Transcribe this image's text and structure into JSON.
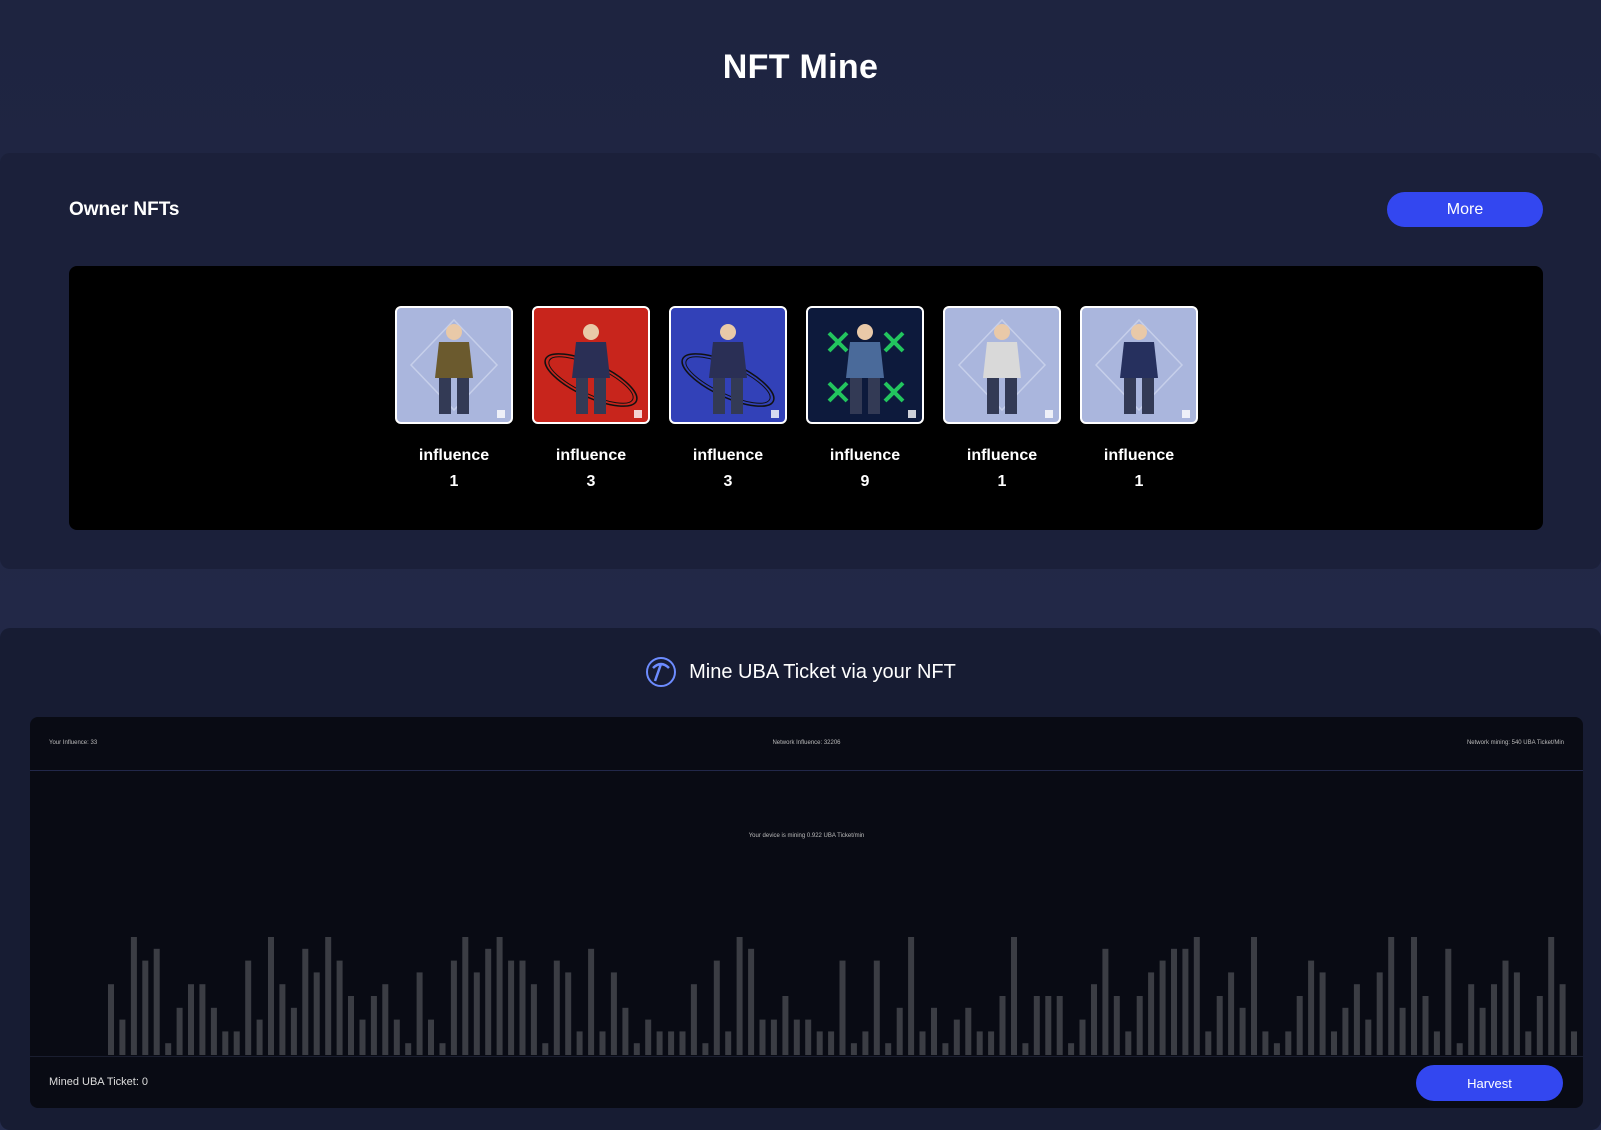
{
  "page": {
    "title": "NFT Mine"
  },
  "owner": {
    "title": "Owner NFTs",
    "more_label": "More",
    "nfts": [
      {
        "label": "influence",
        "value": "1",
        "bg": "#aab6dd",
        "art": "brown-jacket-figure"
      },
      {
        "label": "influence",
        "value": "3",
        "bg": "#c8251c",
        "art": "orbit-figure"
      },
      {
        "label": "influence",
        "value": "3",
        "bg": "#3241b8",
        "art": "orbit-figure"
      },
      {
        "label": "influence",
        "value": "9",
        "bg": "#0d1a3c",
        "art": "cross-figure"
      },
      {
        "label": "influence",
        "value": "1",
        "bg": "#aab6dd",
        "art": "patterned-vest-figure"
      },
      {
        "label": "influence",
        "value": "1",
        "bg": "#aab6dd",
        "art": "hoodie-figure"
      }
    ]
  },
  "mine": {
    "title": "Mine UBA Ticket via your NFT",
    "icon": "pickaxe-icon",
    "your_influence": "Your Influence: 33",
    "network_influence": "Network Influence: 32206",
    "network_mining": "Network mining: 540 UBA Ticket/Min",
    "device_rate": "Your device is mining 0.922 UBA Ticket/min",
    "mined_label": "Mined UBA Ticket: 0",
    "harvest_label": "Harvest"
  },
  "colors": {
    "accent": "#3347f0",
    "bar": "#3b3d44",
    "panel": "#1b203a"
  },
  "chart_data": {
    "type": "bar",
    "values": [
      6,
      3,
      10,
      8,
      9,
      1,
      4,
      6,
      6,
      4,
      2,
      2,
      8,
      3,
      10,
      6,
      4,
      9,
      7,
      10,
      8,
      5,
      3,
      5,
      6,
      3,
      1,
      7,
      3,
      1,
      8,
      10,
      7,
      9,
      10,
      8,
      8,
      6,
      1,
      8,
      7,
      2,
      9,
      2,
      7,
      4,
      1,
      3,
      2,
      2,
      2,
      6,
      1,
      8,
      2,
      10,
      9,
      3,
      3,
      5,
      3,
      3,
      2,
      2,
      8,
      1,
      2,
      8,
      1,
      4,
      10,
      2,
      4,
      1,
      3,
      4,
      2,
      2,
      5,
      10,
      1,
      5,
      5,
      5,
      1,
      3,
      6,
      9,
      5,
      2,
      5,
      7,
      8,
      9,
      9,
      10,
      2,
      5,
      7,
      4,
      10,
      2,
      1,
      2,
      5,
      8,
      7,
      2,
      4,
      6,
      3,
      7,
      10,
      4,
      10,
      5,
      2,
      9,
      1,
      6,
      4,
      6,
      8,
      7,
      2,
      5,
      10,
      6,
      2
    ]
  }
}
